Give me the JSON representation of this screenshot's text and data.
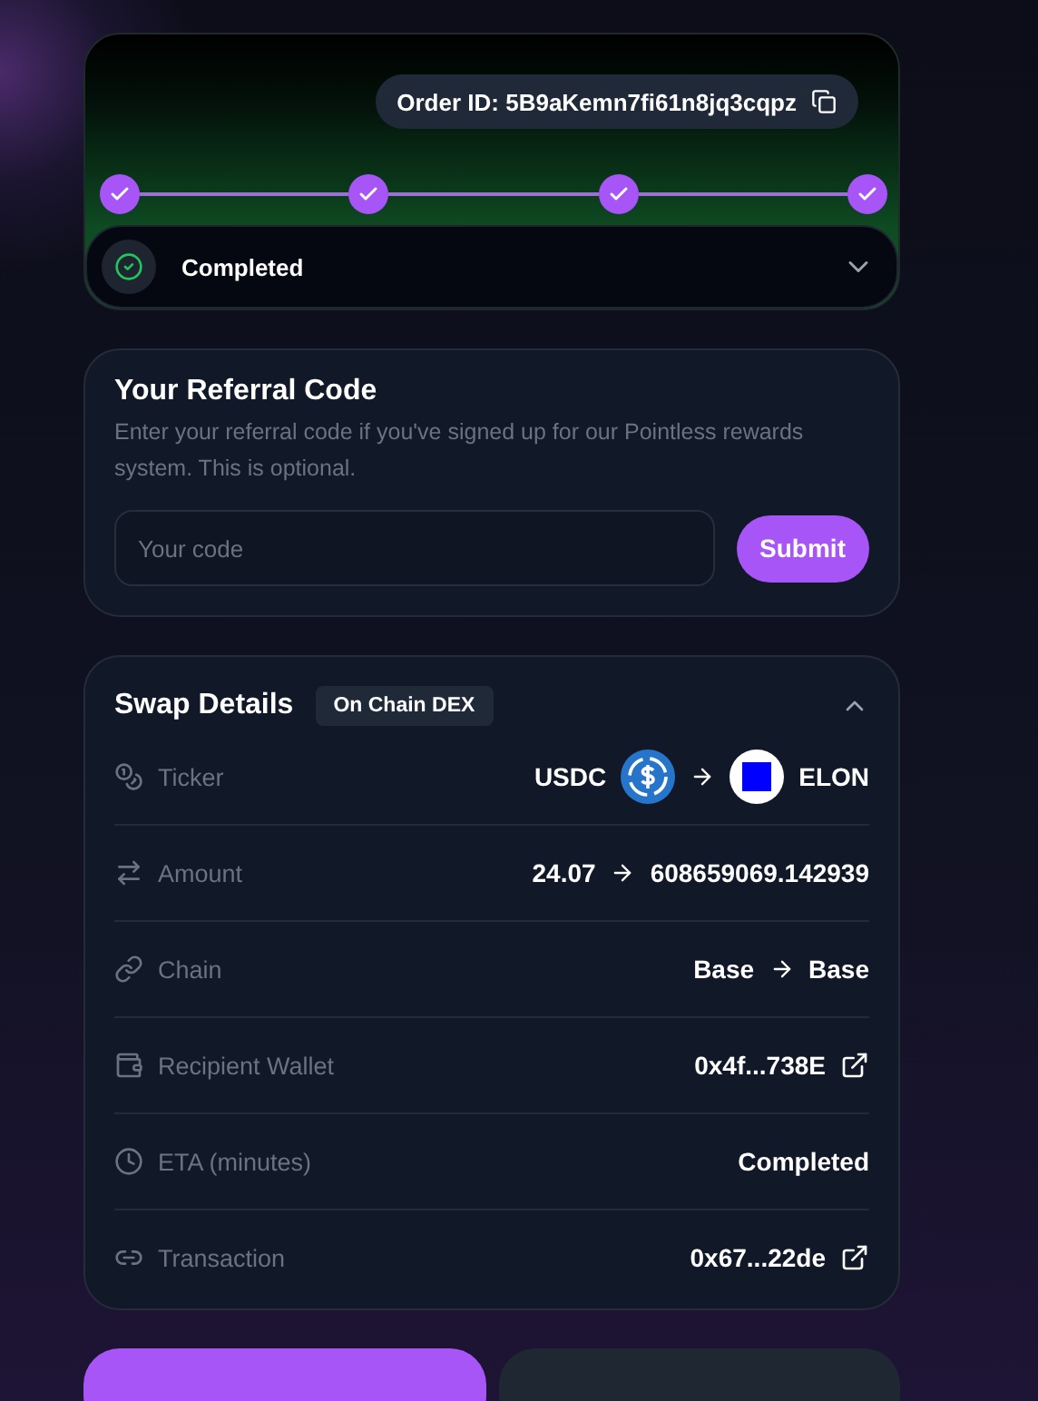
{
  "order": {
    "label": "Order ID: 5B9aKemn7fi61n8jq3cqpz"
  },
  "steps": [
    {
      "done": true
    },
    {
      "done": true
    },
    {
      "done": true
    },
    {
      "done": true
    }
  ],
  "status": {
    "label": "Completed",
    "expanded": false
  },
  "referral": {
    "title": "Your Referral Code",
    "description": "Enter your referral code if you've signed up for our Pointless rewards system. This is optional.",
    "placeholder": "Your code",
    "button": "Submit"
  },
  "swap": {
    "title": "Swap Details",
    "badge": "On Chain DEX",
    "expanded": true,
    "rows": [
      {
        "kind": "tokens",
        "label": "Ticker",
        "from": "USDC",
        "to": "ELON"
      },
      {
        "kind": "pair",
        "label": "Amount",
        "from": "24.07",
        "to": "608659069.142939"
      },
      {
        "kind": "pair",
        "label": "Chain",
        "from": "Base",
        "to": "Base"
      },
      {
        "kind": "link",
        "label": "Recipient Wallet",
        "value": "0x4f...738E"
      },
      {
        "kind": "text",
        "label": "ETA (minutes)",
        "value": "Completed"
      },
      {
        "kind": "link",
        "label": "Transaction",
        "value": "0x67...22de"
      }
    ]
  },
  "actions": [
    {
      "kind": "primary"
    },
    {
      "kind": "secondary"
    }
  ]
}
